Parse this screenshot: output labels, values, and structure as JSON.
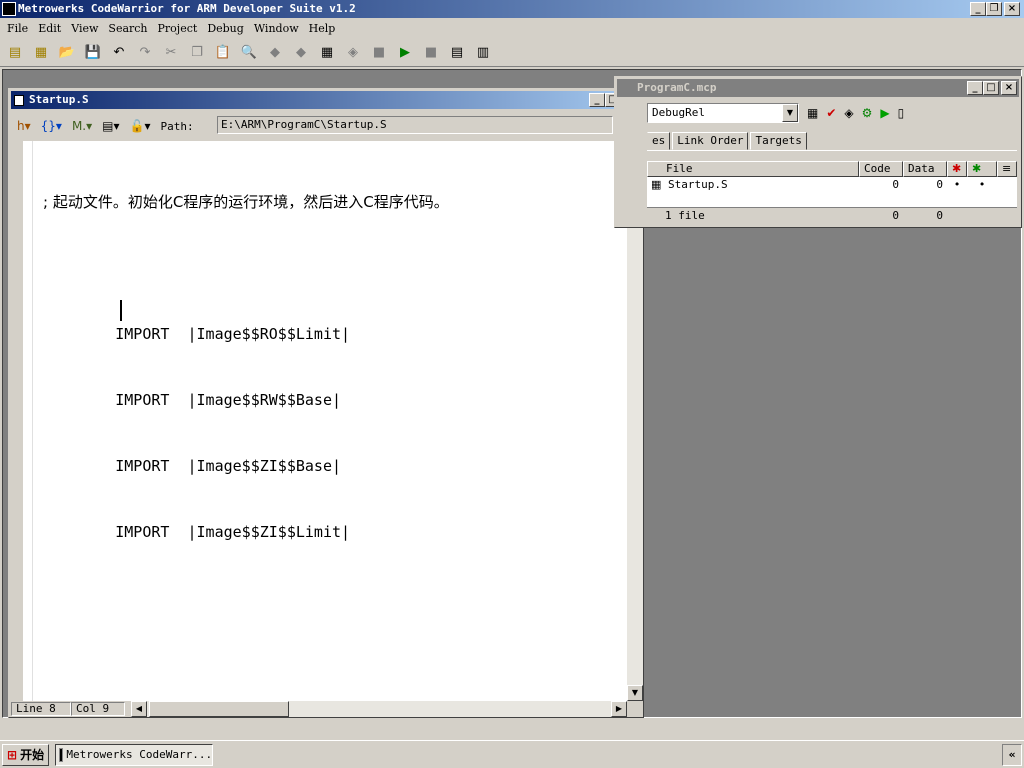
{
  "app": {
    "title": "Metrowerks CodeWarrior for ARM Developer Suite v1.2"
  },
  "menu": [
    "File",
    "Edit",
    "View",
    "Search",
    "Project",
    "Debug",
    "Window",
    "Help"
  ],
  "toolbar_icons": [
    "new-project-icon",
    "new-file-icon",
    "open-icon",
    "save-icon",
    "undo-icon",
    "redo-icon",
    "cut-icon",
    "copy-icon",
    "paste-icon",
    "find-icon",
    "find-next-icon",
    "compile-icon",
    "make-icon",
    "browser-icon",
    "check-icon",
    "run-icon",
    "debug-icon",
    "stop-icon",
    "page-icon",
    "props-icon"
  ],
  "editor": {
    "title": "Startup.S",
    "path_label": "Path:",
    "path": "E:\\ARM\\ProgramC\\Startup.S",
    "lines": [
      "; 起动文件。初始化C程序的运行环境，然后进入C程序代码。",
      "",
      "        IMPORT  |Image$$RO$$Limit|",
      "        IMPORT  |Image$$RW$$Base|",
      "        IMPORT  |Image$$ZI$$Base|",
      "        IMPORT  |Image$$ZI$$Limit|"
    ],
    "status": {
      "line": "Line 8",
      "col": "Col 9"
    }
  },
  "project": {
    "title": "ProgramC.mcp",
    "target": "DebugRel",
    "tabs": [
      "es",
      "Link Order",
      "Targets"
    ],
    "columns": [
      "File",
      "Code",
      "Data"
    ],
    "rows": [
      {
        "file": "Startup.S",
        "code": "0",
        "data": "0",
        "d1": "•",
        "d2": "•"
      }
    ],
    "footer": {
      "files": "1 file",
      "code": "0",
      "data": "0"
    }
  },
  "taskbar": {
    "start": "开始",
    "item": "Metrowerks CodeWarr...",
    "tray": "«"
  }
}
